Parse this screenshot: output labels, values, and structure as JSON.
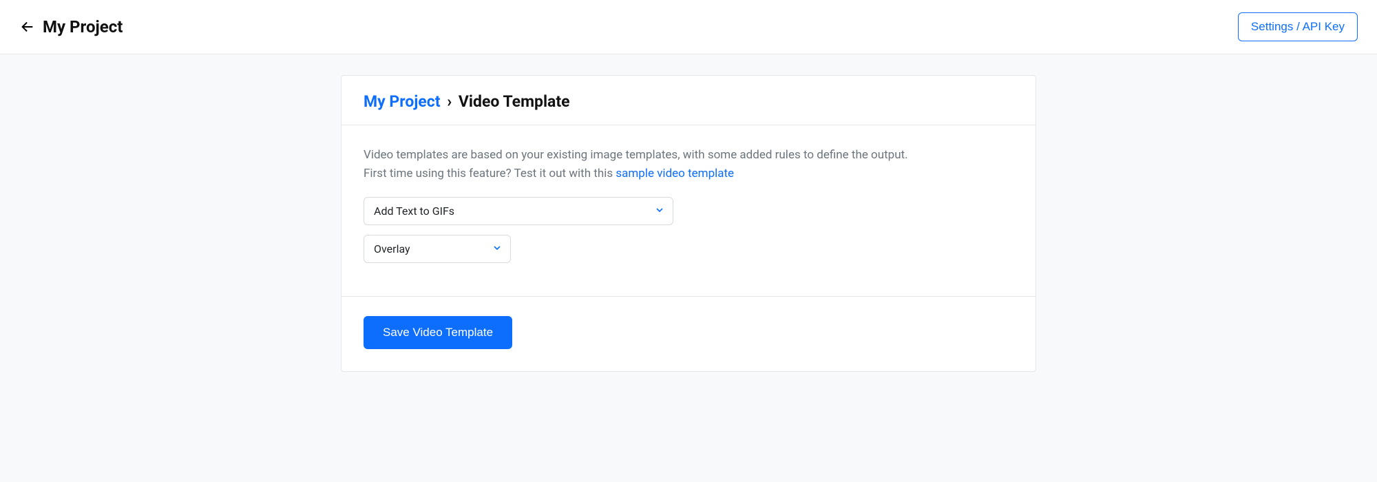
{
  "header": {
    "title": "My Project",
    "settings_label": "Settings / API Key"
  },
  "breadcrumb": {
    "root": "My Project",
    "separator": "›",
    "current": "Video Template"
  },
  "body": {
    "description_line1": "Video templates are based on your existing image templates, with some added rules to define the output.",
    "description_line2_pre": "First time using this feature? Test it out with this ",
    "sample_link_label": "sample video template",
    "select_template": {
      "selected": "Add Text to GIFs"
    },
    "select_mode": {
      "selected": "Overlay"
    }
  },
  "footer": {
    "save_label": "Save Video Template"
  }
}
